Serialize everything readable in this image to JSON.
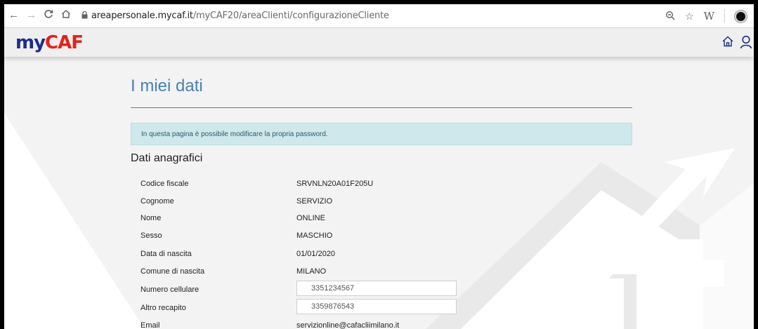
{
  "browser": {
    "url_host": "areapersonale.mycaf.it",
    "url_path": "/myCAF20/areaClienti/configurazioneCliente",
    "nav_icons": [
      "back-arrow-icon",
      "forward-arrow-icon",
      "reload-icon",
      "home-icon"
    ],
    "toolbar_icons": [
      "zoom-icon",
      "bookmark-star-icon",
      "extension-w-icon",
      "profile-icon"
    ],
    "toolbar_w": "W"
  },
  "header": {
    "logo_my": "my",
    "logo_caf": "CAF",
    "icons": [
      "home-icon",
      "user-icon"
    ],
    "accent_color": "#1e2d8c",
    "brand_red": "#e2231a"
  },
  "page": {
    "title": "I miei dati",
    "alert": "In questa pagina è possibile modificare la propria password.",
    "section_title": "Dati anagrafici",
    "fields": [
      {
        "label": "Codice fiscale",
        "value": "SRVNLN20A01F205U"
      },
      {
        "label": "Cognome",
        "value": "SERVIZIO"
      },
      {
        "label": "Nome",
        "value": "ONLINE"
      },
      {
        "label": "Sesso",
        "value": "MASCHIO"
      },
      {
        "label": "Data di nascita",
        "value": "01/01/2020"
      },
      {
        "label": "Comune di nascita",
        "value": "MILANO"
      }
    ],
    "inputs": [
      {
        "label": "Numero cellulare",
        "value": "3351234567"
      },
      {
        "label": "Altro recapito",
        "value": "3359876543"
      }
    ],
    "email": {
      "label": "Email",
      "value": "servizionline@cafacliimilano.it"
    },
    "title_color": "#4a7fb7",
    "alert_bg": "#cfe8ec"
  }
}
